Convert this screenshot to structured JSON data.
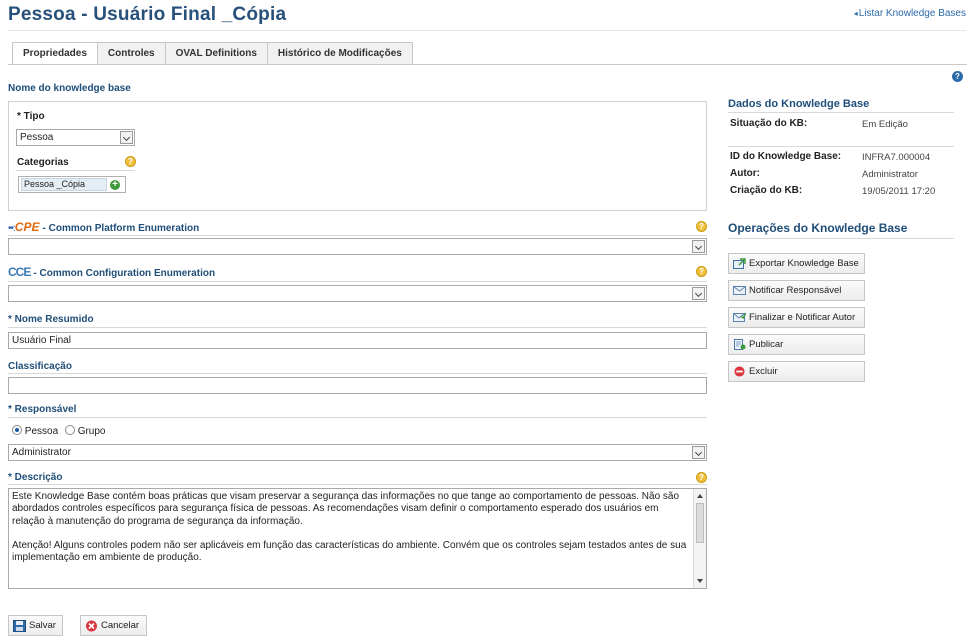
{
  "header": {
    "title": "Pessoa - Usuário Final _Cópia",
    "back_link": "Listar Knowledge Bases"
  },
  "tabs": [
    {
      "label": "Propriedades",
      "active": true
    },
    {
      "label": "Controles",
      "active": false
    },
    {
      "label": "OVAL Definitions",
      "active": false
    },
    {
      "label": "Histórico de Modificações",
      "active": false
    }
  ],
  "form": {
    "section_title": "Nome do knowledge base",
    "tipo": {
      "label": "Tipo",
      "value": "Pessoa"
    },
    "categorias": {
      "label": "Categorias",
      "chip": "Pessoa _Cópia"
    },
    "cpe": {
      "logo": "CPE",
      "label": "- Common Platform Enumeration",
      "value": ""
    },
    "cce": {
      "logo": "CCE",
      "label": "- Common Configuration Enumeration",
      "value": ""
    },
    "nome_resumido": {
      "label": "Nome Resumido",
      "value": "Usuário Final"
    },
    "classificacao": {
      "label": "Classificação",
      "value": ""
    },
    "responsavel": {
      "label": "Responsável",
      "options": [
        "Pessoa",
        "Grupo"
      ],
      "selected": "Pessoa",
      "value": "Administrator"
    },
    "descricao": {
      "label": "Descrição",
      "paragraph1": "Este Knowledge Base contém boas práticas que visam preservar a segurança das informações no que tange ao comportamento de pessoas. Não são abordados controles específicos para segurança física de pessoas. As recomendações visam definir o comportamento esperado dos usuários em relação à manutenção do programa de segurança da informação.",
      "paragraph2": "Atenção! Alguns controles podem não ser aplicáveis em função das características do ambiente. Convém que os controles sejam testados antes de sua implementação em ambiente de produção."
    }
  },
  "kb_data": {
    "title": "Dados do Knowledge Base",
    "situacao": {
      "label": "Situação do KB:",
      "value": "Em Edição"
    },
    "id": {
      "label": "ID do Knowledge Base:",
      "value": "INFRA7.000004"
    },
    "autor": {
      "label": "Autor:",
      "value": "Administrator"
    },
    "criacao": {
      "label": "Criação do KB:",
      "value": "19/05/2011 17:20"
    }
  },
  "operations": {
    "title": "Operações do Knowledge Base",
    "buttons": [
      "Exportar Knowledge Base",
      "Notificar Responsável",
      "Finalizar e Notificar Autor",
      "Publicar",
      "Excluir"
    ]
  },
  "footer": {
    "save": "Salvar",
    "cancel": "Cancelar"
  },
  "colors": {
    "title": "#27507a",
    "section": "#1f4e79",
    "link": "#2d6aa8",
    "help": "#f0c040"
  }
}
